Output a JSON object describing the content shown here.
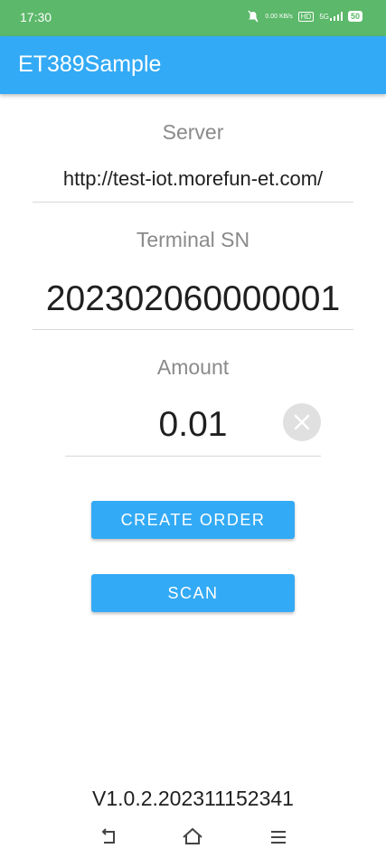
{
  "status_bar": {
    "time": "17:30",
    "net_speed": "0.00 KB/s",
    "hd": "HD",
    "signal": "5G",
    "battery": "50"
  },
  "app_bar": {
    "title": "ET389Sample",
    "background": "#33aaf5"
  },
  "form": {
    "server_label": "Server",
    "server_value": "http://test-iot.morefun-et.com/",
    "sn_label": "Terminal SN",
    "sn_value": "202302060000001",
    "amount_label": "Amount",
    "amount_value": "0.01"
  },
  "buttons": {
    "create_order": "CREATE ORDER",
    "scan": "SCAN"
  },
  "footer": {
    "version": "V1.0.2.202311152341"
  },
  "icons": [
    "mute-icon",
    "signal-icon",
    "battery-icon",
    "clear-icon",
    "back-nav-icon",
    "home-nav-icon",
    "menu-nav-icon"
  ]
}
